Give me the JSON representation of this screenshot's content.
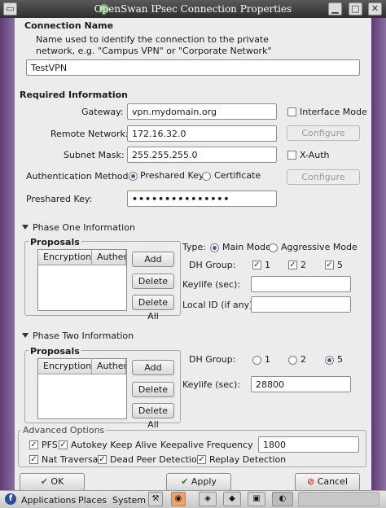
{
  "window": {
    "title": "OpenSwan IPsec Connection Properties"
  },
  "colors": {
    "desktop": "#6a4a7c",
    "dialog_bg": "#ececec",
    "radio_accent": "#3a5f9a"
  },
  "connection_name": {
    "section_title": "Connection Name",
    "help_line1": "Name used to identify the connection to the private",
    "help_line2": "network, e.g. \"Campus VPN\" or \"Corporate Network\"",
    "value": "TestVPN"
  },
  "required": {
    "section_title": "Required Information",
    "gateway_label": "Gateway:",
    "gateway_value": "vpn.mydomain.org",
    "remote_network_label": "Remote Network:",
    "remote_network_value": "172.16.32.0",
    "subnet_mask_label": "Subnet Mask:",
    "subnet_mask_value": "255.255.255.0",
    "auth_method_label": "Authentication Method:",
    "auth_option_psk": "Preshared Key",
    "auth_option_cert": "Certificate",
    "auth_selected": "Preshared Key",
    "preshared_key_label": "Preshared Key:",
    "preshared_key_value": "•••••••••••••••",
    "interface_mode_label": "Interface Mode",
    "interface_mode_checked": false,
    "x_auth_label": "X-Auth",
    "x_auth_checked": false,
    "configure_label": "Configure"
  },
  "phase_one": {
    "expander_label": "Phase One Information",
    "proposals_title": "Proposals",
    "col_encryption": "Encryption",
    "col_auth": "Authen",
    "add_label": "Add",
    "delete_label": "Delete",
    "delete_all_label": "Delete All",
    "type_label": "Type:",
    "type_main": "Main Mode",
    "type_aggressive": "Aggressive Mode",
    "type_selected": "Main Mode",
    "dh_group_label": "DH Group:",
    "dh_options": [
      "1",
      "2",
      "5"
    ],
    "dh_checked": [
      true,
      true,
      true
    ],
    "keylife_label": "Keylife (sec):",
    "keylife_value": "",
    "local_id_label": "Local ID (if any):",
    "local_id_value": ""
  },
  "phase_two": {
    "expander_label": "Phase Two Information",
    "proposals_title": "Proposals",
    "col_encryption": "Encryption",
    "col_auth": "Authen",
    "add_label": "Add",
    "delete_label": "Delete",
    "delete_all_label": "Delete All",
    "dh_group_label": "DH Group:",
    "dh_options": [
      "1",
      "2",
      "5"
    ],
    "dh_selected": "5",
    "keylife_label": "Keylife (sec):",
    "keylife_value": "28800"
  },
  "advanced": {
    "section_title": "Advanced Options",
    "pfs_label": "PFS",
    "pfs_checked": true,
    "autokey_label": "Autokey Keep Alive",
    "autokey_checked": true,
    "keepalive_label": "Keepalive Frequency",
    "keepalive_value": "1800",
    "nat_label": "Nat Traversal",
    "nat_checked": true,
    "dpd_label": "Dead Peer Detection",
    "dpd_checked": true,
    "replay_label": "Replay Detection",
    "replay_checked": true
  },
  "footer": {
    "ok_label": "OK",
    "apply_label": "Apply",
    "cancel_label": "Cancel"
  },
  "taskbar": {
    "applications": "Applications",
    "places": "Places",
    "system": "System"
  }
}
